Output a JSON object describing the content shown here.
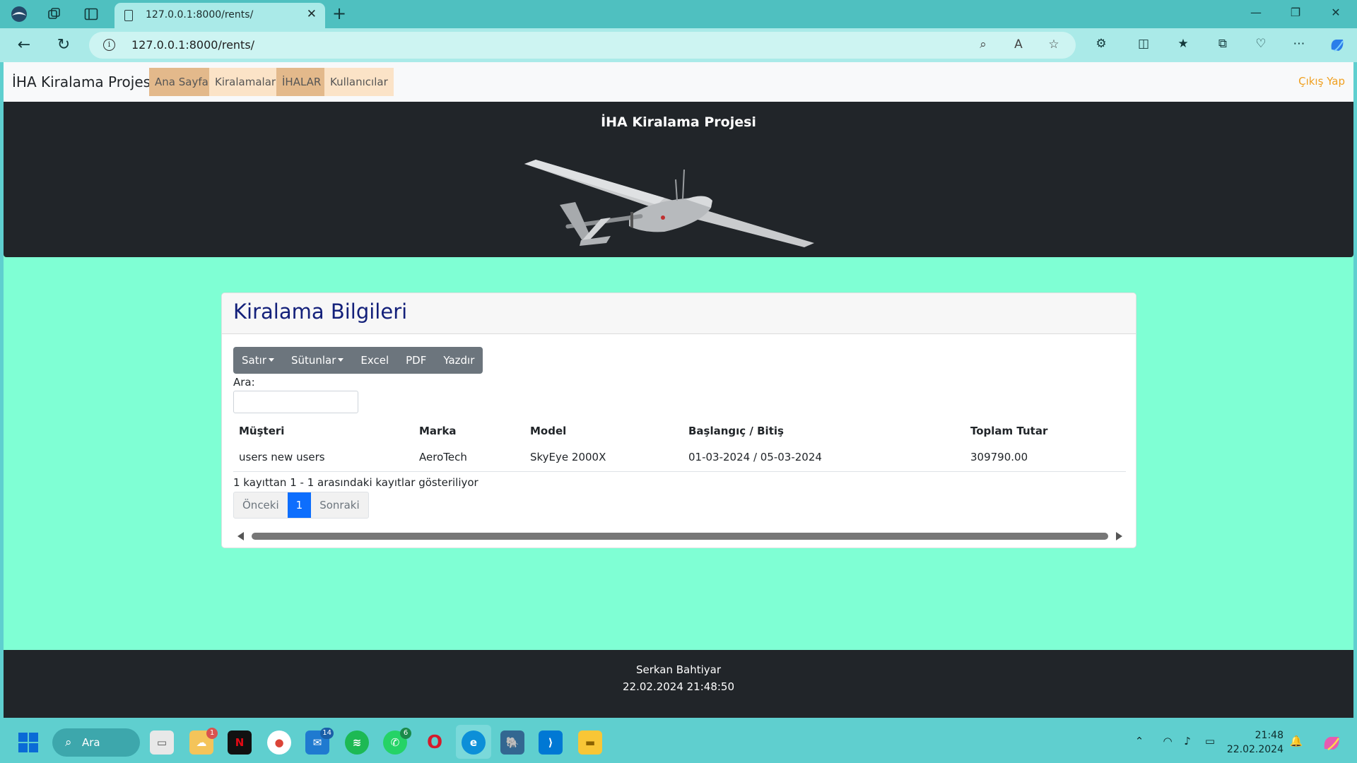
{
  "browser": {
    "tab_title": "127.0.0.1:8000/rents/",
    "url": "127.0.0.1:8000/rents/"
  },
  "navbar": {
    "brand": "İHA Kiralama Projesi",
    "links": [
      {
        "label": "Ana Sayfa"
      },
      {
        "label": "Kiralamalar"
      },
      {
        "label": "İHALAR"
      },
      {
        "label": "Kullanıcılar"
      }
    ],
    "logout": "Çıkış Yap"
  },
  "hero": {
    "title": "İHA Kiralama Projesi"
  },
  "card": {
    "title": "Kiralama Bilgileri",
    "buttons": {
      "rows": "Satır",
      "columns": "Sütunlar",
      "excel": "Excel",
      "pdf": "PDF",
      "print": "Yazdır"
    },
    "search_label": "Ara:",
    "table": {
      "headers": [
        "Müşteri",
        "Marka",
        "Model",
        "Başlangıç / Bitiş",
        "Toplam Tutar"
      ],
      "rows": [
        [
          "users new users",
          "AeroTech",
          "SkyEye 2000X",
          "01-03-2024 / 05-03-2024",
          "309790.00"
        ]
      ]
    },
    "info": "1 kayıttan 1 - 1 arasındaki kayıtlar gösteriliyor",
    "pagination": {
      "prev": "Önceki",
      "current": "1",
      "next": "Sonraki"
    }
  },
  "footer": {
    "name": "Serkan Bahtiyar",
    "datetime": "22.02.2024 21:48:50"
  },
  "taskbar": {
    "search": "Ara",
    "badges": {
      "weather": "1",
      "mail": "14",
      "whatsapp": "6"
    },
    "clock_time": "21:48",
    "clock_date": "22.02.2024"
  },
  "colors": {
    "page_bg": "#7fffd4",
    "dark": "#212529",
    "card_title": "#13207a",
    "active_page": "#0d6efd",
    "nav_active": "#e3b98b",
    "nav_inactive": "#fbe3c7",
    "logout": "#f0a020"
  }
}
